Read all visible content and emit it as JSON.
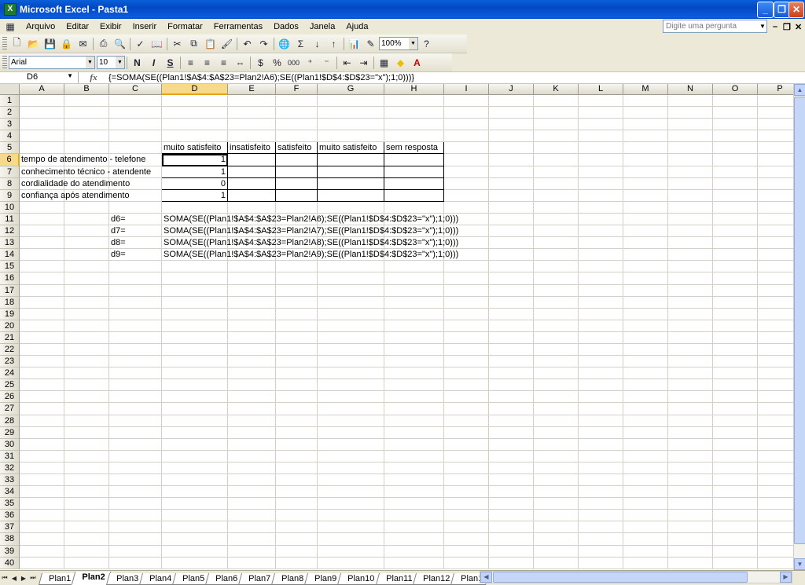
{
  "window": {
    "title": "Microsoft Excel - Pasta1",
    "app_icon": "excel-icon"
  },
  "menu": [
    "Arquivo",
    "Editar",
    "Exibir",
    "Inserir",
    "Formatar",
    "Ferramentas",
    "Dados",
    "Janela",
    "Ajuda"
  ],
  "help_placeholder": "Digite uma pergunta",
  "toolbar": {
    "zoom": "100%",
    "font_name": "Arial",
    "font_size": "10",
    "bold": "N",
    "italic": "I",
    "underline": "S",
    "percent": "%",
    "thousands": "000"
  },
  "formula_bar": {
    "name_box": "D6",
    "fx": "fx",
    "formula": "{=SOMA(SE((Plan1!$A$4:$A$23=Plan2!A6);SE((Plan1!$D$4:$D$23=\"x\");1;0)))}"
  },
  "columns": [
    "A",
    "B",
    "C",
    "D",
    "E",
    "F",
    "G",
    "H",
    "I",
    "J",
    "K",
    "L",
    "M",
    "N",
    "O",
    "P"
  ],
  "cells": {
    "D5": "muito satisfeito",
    "E5": "insatisfeito",
    "F5": "satisfeito",
    "G5": "muito satisfeito",
    "H5": "sem resposta",
    "A6": "tempo de atendimento - telefone",
    "D6": "1",
    "A7": "conhecimento técnico - atendente",
    "D7": "1",
    "A8": "cordialidade do atendimento",
    "D8": "0",
    "A9": "confiança após atendimento",
    "D9": "1",
    "C11": "d6=",
    "D11": "SOMA(SE((Plan1!$A$4:$A$23=Plan2!A6);SE((Plan1!$D$4:$D$23=\"x\");1;0)))",
    "C12": "d7=",
    "D12": "SOMA(SE((Plan1!$A$4:$A$23=Plan2!A7);SE((Plan1!$D$4:$D$23=\"x\");1;0)))",
    "C13": "d8=",
    "D13": "SOMA(SE((Plan1!$A$4:$A$23=Plan2!A8);SE((Plan1!$D$4:$D$23=\"x\");1;0)))",
    "C14": "d9=",
    "D14": "SOMA(SE((Plan1!$A$4:$A$23=Plan2!A9);SE((Plan1!$D$4:$D$23=\"x\");1;0)))"
  },
  "active_cell": "D6",
  "sheet_tabs": [
    "Plan1",
    "Plan2",
    "Plan3",
    "Plan4",
    "Plan5",
    "Plan6",
    "Plan7",
    "Plan8",
    "Plan9",
    "Plan10",
    "Plan11",
    "Plan12",
    "Plan1"
  ],
  "active_tab": "Plan2",
  "row_count": 40
}
